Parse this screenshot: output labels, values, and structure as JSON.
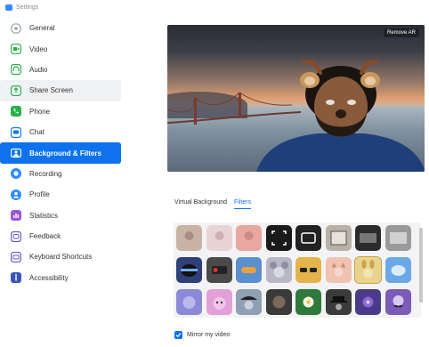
{
  "window": {
    "title": "Settings"
  },
  "colors": {
    "accent": "#0e72ed",
    "text": "#333333",
    "muted": "#8a8a8a"
  },
  "sidebar": {
    "items": [
      {
        "label": "General",
        "icon": "gear-icon",
        "color": "#9aa0a6"
      },
      {
        "label": "Video",
        "icon": "video-camera-icon",
        "color": "#27b04a"
      },
      {
        "label": "Audio",
        "icon": "headphones-icon",
        "color": "#27b04a"
      },
      {
        "label": "Share Screen",
        "icon": "share-screen-icon",
        "color": "#27b04a"
      },
      {
        "label": "Phone",
        "icon": "phone-icon",
        "color": "#27b04a"
      },
      {
        "label": "Chat",
        "icon": "chat-icon",
        "color": "#0e72ed"
      },
      {
        "label": "Background & Filters",
        "icon": "background-icon",
        "color": "#ffffff"
      },
      {
        "label": "Recording",
        "icon": "recording-icon",
        "color": "#2d8cff"
      },
      {
        "label": "Profile",
        "icon": "profile-icon",
        "color": "#2d8cff"
      },
      {
        "label": "Statistics",
        "icon": "statistics-icon",
        "color": "#9b59d0"
      },
      {
        "label": "Feedback",
        "icon": "feedback-icon",
        "color": "#6b55c9"
      },
      {
        "label": "Keyboard Shortcuts",
        "icon": "keyboard-icon",
        "color": "#6b55c9"
      },
      {
        "label": "Accessibility",
        "icon": "accessibility-icon",
        "color": "#3c55b5"
      }
    ],
    "active_index": 6
  },
  "preview": {
    "remove_label": "Remove AR"
  },
  "tabs": [
    {
      "label": "Virtual Background"
    },
    {
      "label": "Filters"
    }
  ],
  "active_tab": 1,
  "filters": [
    {
      "name": "filter-beige-tint",
      "color": "#c9b3a5"
    },
    {
      "name": "filter-pink-tint",
      "color": "#e8d4d4"
    },
    {
      "name": "filter-rose-tint",
      "color": "#e9a7a2"
    },
    {
      "name": "filter-frame-focus",
      "color": "#1a1a1a"
    },
    {
      "name": "filter-tv-frame",
      "color": "#222222"
    },
    {
      "name": "filter-photo-frame",
      "color": "#b8b2a6"
    },
    {
      "name": "filter-film-frame",
      "color": "#2b2b2b"
    },
    {
      "name": "filter-retro-frame",
      "color": "#9a9a9a"
    },
    {
      "name": "filter-space-helmet",
      "color": "#2f3f7a"
    },
    {
      "name": "filter-vr-goggles",
      "color": "#4a4a4a"
    },
    {
      "name": "filter-ski-goggles",
      "color": "#5a8fd0"
    },
    {
      "name": "filter-koala",
      "color": "#b7b7c5"
    },
    {
      "name": "filter-sunglasses",
      "color": "#e2b44b"
    },
    {
      "name": "filter-cat-ears",
      "color": "#f0c2b0"
    },
    {
      "name": "filter-bunny-ears",
      "color": "#e8d48a"
    },
    {
      "name": "filter-cloud-face",
      "color": "#6aa8e8"
    },
    {
      "name": "filter-bubble-face",
      "color": "#8a8ad8"
    },
    {
      "name": "filter-pink-monster",
      "color": "#e2a0d6"
    },
    {
      "name": "filter-pirate-hat",
      "color": "#8fa0b5"
    },
    {
      "name": "filter-dark-portrait",
      "color": "#3a3a3a"
    },
    {
      "name": "filter-flower-crown",
      "color": "#2e7a3a"
    },
    {
      "name": "filter-detective-hat",
      "color": "#3b3b3b"
    },
    {
      "name": "filter-purple-galaxy",
      "color": "#4a3a8a"
    },
    {
      "name": "filter-mustache",
      "color": "#7a5bb8"
    }
  ],
  "mirror": {
    "label": "Mirror my video",
    "checked": true
  }
}
